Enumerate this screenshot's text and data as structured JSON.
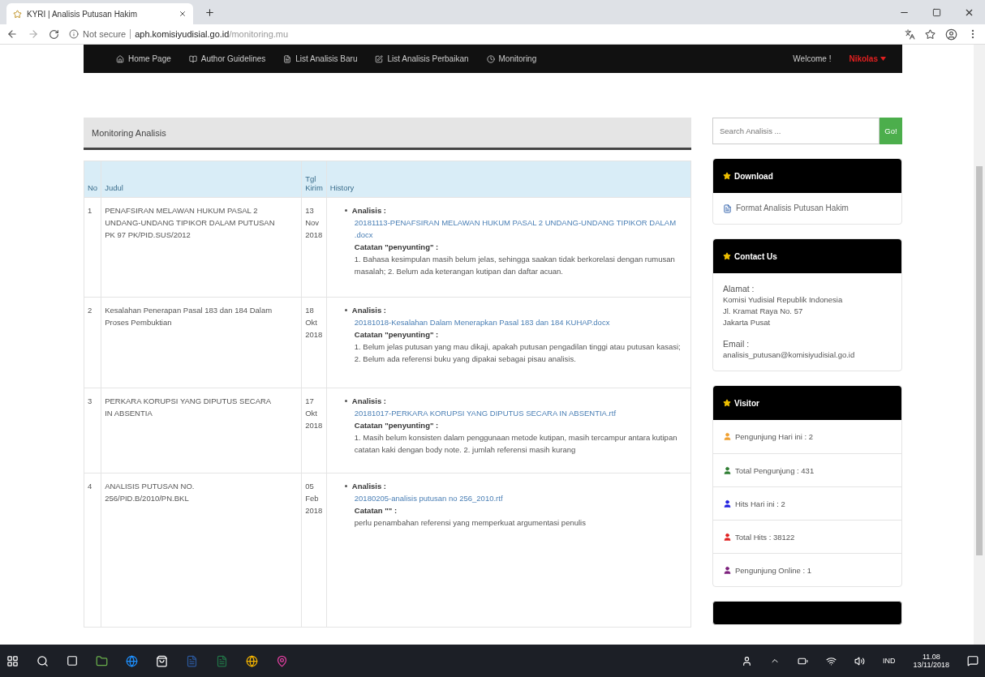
{
  "browser": {
    "tab_title": "KYRI | Analisis Putusan Hakim",
    "security": "Not secure",
    "url_domain": "aph.komisiyudisial.go.id",
    "url_path": "/monitoring.mu"
  },
  "nav": {
    "items": [
      {
        "label": "Home Page"
      },
      {
        "label": "Author Guidelines"
      },
      {
        "label": "List Analisis Baru"
      },
      {
        "label": "List Analisis Perbaikan"
      },
      {
        "label": "Monitoring"
      }
    ],
    "welcome": "Welcome !",
    "user": "Nikolas"
  },
  "panel_title": "Monitoring Analisis",
  "table": {
    "columns": [
      "No",
      "Judul",
      "Tgl Kirim",
      "History"
    ],
    "rows": [
      {
        "no": "1",
        "judul": "PENAFSIRAN MELAWAN HUKUM PASAL 2 UNDANG-UNDANG TIPIKOR DALAM PUTUSAN PK 97 PK/PID.SUS/2012",
        "date": "13 Nov 2018",
        "analisis_label": "Analisis :",
        "file": "20181113-PENAFSIRAN MELAWAN HUKUM PASAL 2 UNDANG-UNDANG TIPIKOR DALAM .docx",
        "catatan_label": "Catatan \"penyunting\" :",
        "catatan": "1. Bahasa kesimpulan masih belum jelas, sehingga saakan tidak berkorelasi dengan rumusan masalah; 2. Belum ada keterangan kutipan dan daftar acuan."
      },
      {
        "no": "2",
        "judul": "Kesalahan Penerapan Pasal 183 dan 184 Dalam Proses Pembuktian",
        "date": "18 Okt 2018",
        "analisis_label": "Analisis :",
        "file": "20181018-Kesalahan Dalam Menerapkan Pasal 183 dan 184 KUHAP.docx",
        "catatan_label": "Catatan \"penyunting\" :",
        "catatan": "1. Belum jelas putusan yang mau dikaji, apakah putusan pengadilan tinggi atau putusan kasasi; 2. Belum ada referensi buku yang dipakai sebagai pisau analisis."
      },
      {
        "no": "3",
        "judul": "PERKARA KORUPSI YANG DIPUTUS SECARA IN ABSENTIA",
        "date": "17 Okt 2018",
        "analisis_label": "Analisis :",
        "file": "20181017-PERKARA KORUPSI YANG DIPUTUS SECARA IN ABSENTIA.rtf",
        "catatan_label": "Catatan \"penyunting\" :",
        "catatan": "1. Masih belum konsisten dalam penggunaan metode kutipan, masih tercampur antara kutipan catatan kaki dengan body note. 2. jumlah referensi masih kurang"
      },
      {
        "no": "4",
        "judul": "ANALISIS PUTUSAN NO. 256/PID.B/2010/PN.BKL",
        "date": "05 Feb 2018",
        "analisis_label": "Analisis :",
        "file": "20180205-analisis putusan no 256_2010.rtf",
        "catatan_label": "Catatan \"\" :",
        "catatan": "perlu penambahan referensi yang memperkuat argumentasi penulis"
      }
    ]
  },
  "search": {
    "placeholder": "Search Analisis ...",
    "button": "Go!"
  },
  "download": {
    "title": "Download",
    "link": "Format Analisis Putusan Hakim"
  },
  "contact": {
    "title": "Contact Us",
    "address_label": "Alamat :",
    "address": [
      "Komisi Yudisial Republik Indonesia",
      "Jl. Kramat Raya No. 57",
      "Jakarta Pusat"
    ],
    "email_label": "Email :",
    "email": "analisis_putusan@komisiyudisial.go.id"
  },
  "visitor": {
    "title": "Visitor",
    "items": [
      {
        "label": "Pengunjung Hari ini : 2",
        "color": "#f0a030"
      },
      {
        "label": "Total Pengunjung : 431",
        "color": "#2e7d32"
      },
      {
        "label": "Hits Hari ini : 2",
        "color": "#2020e0"
      },
      {
        "label": "Total Hits : 38122",
        "color": "#e02020"
      },
      {
        "label": "Pengunjung Online : 1",
        "color": "#7b1f7b"
      }
    ]
  },
  "taskbar": {
    "language": "IND",
    "time": "11.08",
    "date": "13/11/2018"
  }
}
